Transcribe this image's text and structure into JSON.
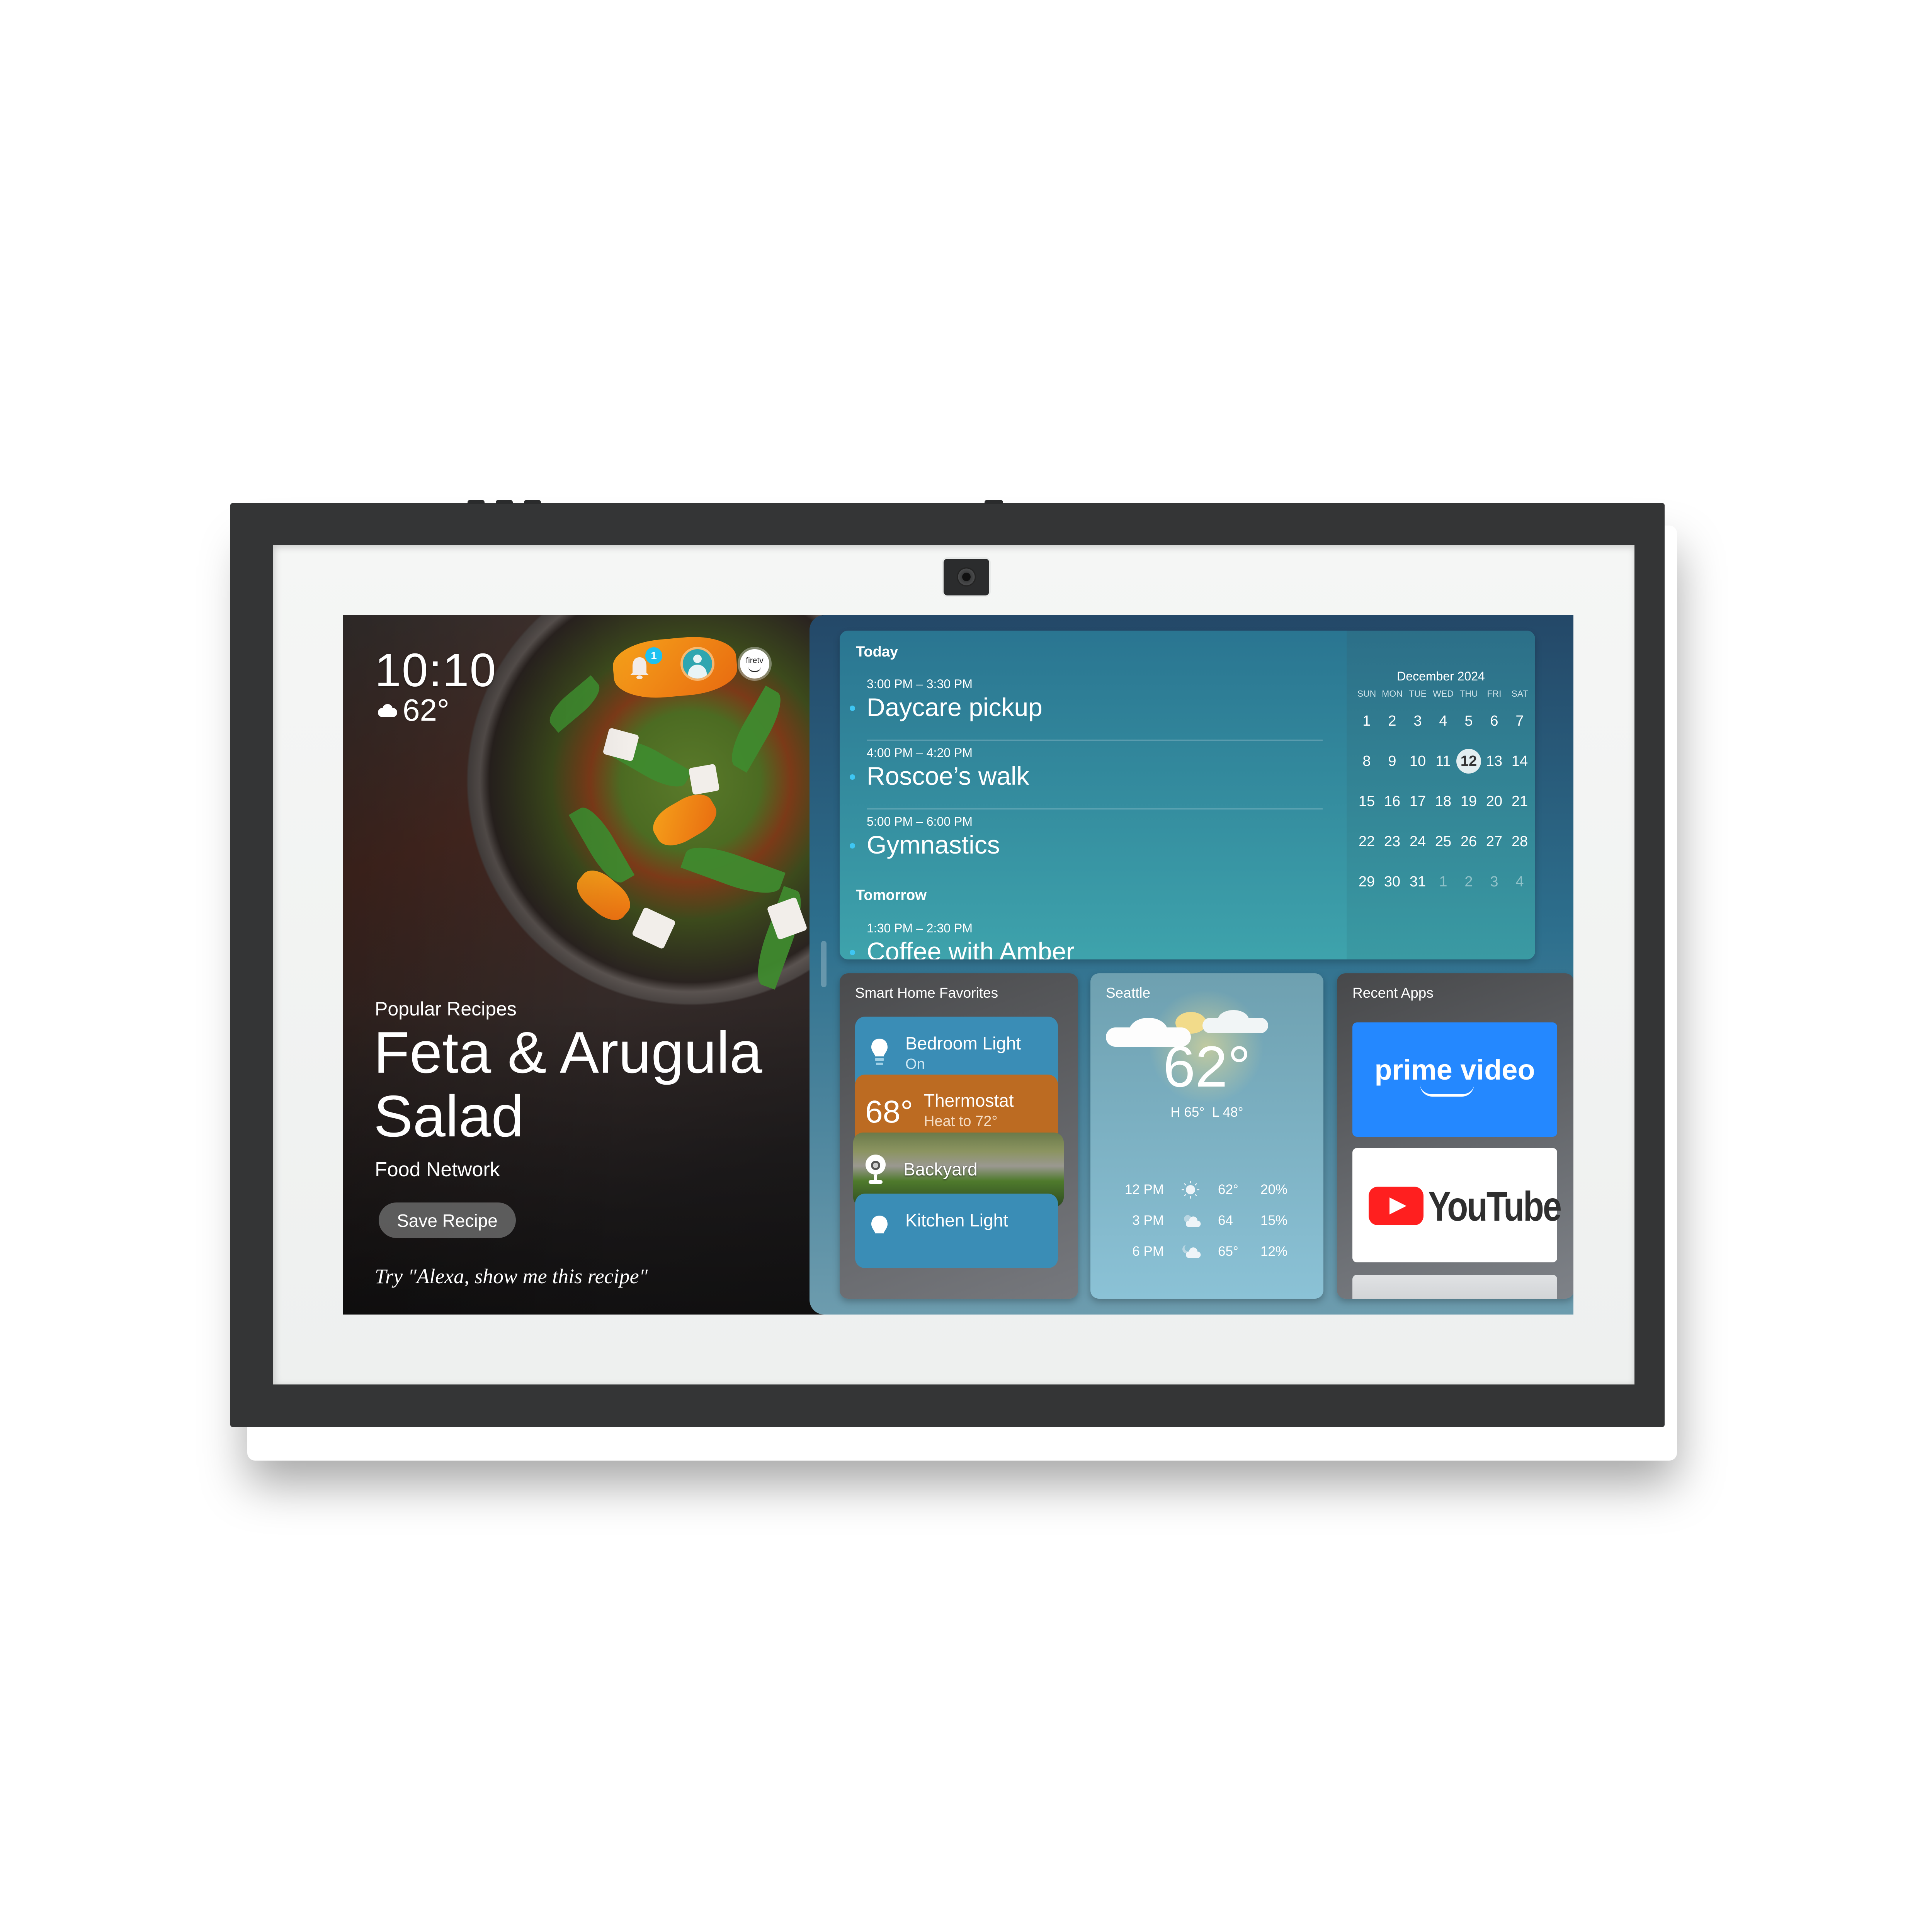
{
  "device": {
    "camera_label": "camera"
  },
  "status_bar": {
    "time": "10:10",
    "temperature": "62°",
    "weather_icon": "partly-cloudy-icon",
    "notification_count": "1",
    "icons": [
      "bell-icon",
      "profile-icon",
      "firetv-icon"
    ],
    "firetv_label": "firetv"
  },
  "recipe": {
    "category": "Popular Recipes",
    "title": "Feta & Arugula Salad",
    "source": "Food Network",
    "save_button": "Save Recipe",
    "voice_hint": "Try \"Alexa, show me this recipe\""
  },
  "calendar": {
    "sections": [
      {
        "label": "Today",
        "events": [
          {
            "time": "3:00 PM – 3:30 PM",
            "name": "Daycare pickup"
          },
          {
            "time": "4:00 PM – 4:20 PM",
            "name": "Roscoe’s walk"
          },
          {
            "time": "5:00 PM – 6:00 PM",
            "name": "Gymnastics"
          }
        ]
      },
      {
        "label": "Tomorrow",
        "events": [
          {
            "time": "1:30 PM – 2:30 PM",
            "name": "Coffee with Amber"
          }
        ]
      }
    ],
    "month_label": "December 2024",
    "weekdays": [
      "SUN",
      "MON",
      "TUE",
      "WED",
      "THU",
      "FRI",
      "SAT"
    ],
    "weeks": [
      [
        "1",
        "2",
        "3",
        "4",
        "5",
        "6",
        "7"
      ],
      [
        "8",
        "9",
        "10",
        "11",
        "12",
        "13",
        "14"
      ],
      [
        "15",
        "16",
        "17",
        "18",
        "19",
        "20",
        "21"
      ],
      [
        "22",
        "23",
        "24",
        "25",
        "26",
        "27",
        "28"
      ],
      [
        "29",
        "30",
        "31",
        "1",
        "2",
        "3",
        "4"
      ]
    ],
    "today": "12",
    "next_month_days_start_index": 3
  },
  "smart_home": {
    "title": "Smart Home Favorites",
    "devices": [
      {
        "name": "Bedroom Light",
        "status": "On",
        "icon": "lightbulb-icon",
        "color": "#3a8db6"
      },
      {
        "name": "Thermostat",
        "status": "Heat to 72°",
        "value": "68°",
        "color": "#bc6b22"
      },
      {
        "name": "Backyard",
        "icon": "camera-icon"
      },
      {
        "name": "Kitchen Light",
        "icon": "lightbulb-icon",
        "color": "#3a8db6"
      }
    ]
  },
  "weather": {
    "city": "Seattle",
    "current": "62°",
    "high_low": "H 65°  L 48°",
    "hourly": [
      {
        "time": "12 PM",
        "icon": "sun-icon",
        "temp": "62°",
        "precip": "20%"
      },
      {
        "time": "3 PM",
        "icon": "partly-cloudy-icon",
        "temp": "64",
        "precip": "15%"
      },
      {
        "time": "6 PM",
        "icon": "night-cloudy-icon",
        "temp": "65°",
        "precip": "12%"
      }
    ]
  },
  "recent_apps": {
    "title": "Recent Apps",
    "apps": [
      {
        "name": "prime video",
        "color": "#2488ff"
      },
      {
        "name": "YouTube",
        "color": "#ff0000"
      },
      {
        "name": ""
      }
    ]
  }
}
